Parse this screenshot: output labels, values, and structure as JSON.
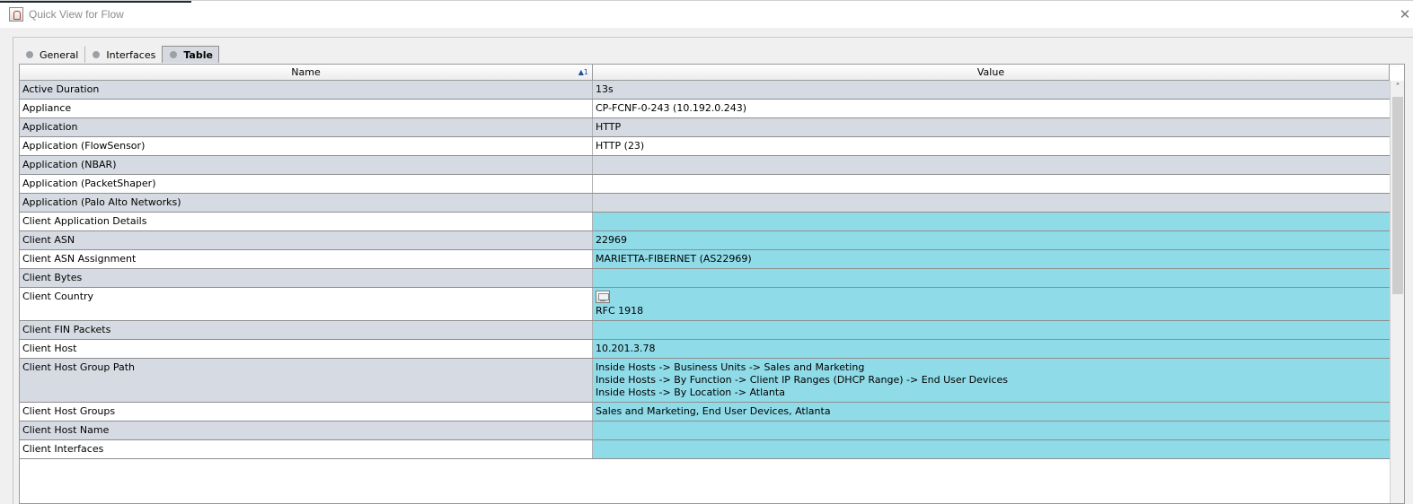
{
  "window": {
    "title": "Quick View for Flow",
    "close_glyph": "✕",
    "app_icon": "java-cup-icon"
  },
  "tabs": [
    {
      "label": "General",
      "active": false
    },
    {
      "label": "Interfaces",
      "active": false
    },
    {
      "label": "Table",
      "active": true
    }
  ],
  "table": {
    "columns": {
      "name": "Name",
      "value": "Value"
    },
    "sort_indicator": "▲1",
    "rows": [
      {
        "name": "Active Duration",
        "value": [
          "13s"
        ],
        "bg": "grey"
      },
      {
        "name": "Appliance",
        "value": [
          "CP-FCNF-0-243 (10.192.0.243)"
        ],
        "bg": "white"
      },
      {
        "name": "Application",
        "value": [
          "HTTP"
        ],
        "bg": "grey"
      },
      {
        "name": "Application (FlowSensor)",
        "value": [
          "HTTP (23)"
        ],
        "bg": "white"
      },
      {
        "name": "Application (NBAR)",
        "value": [
          ""
        ],
        "bg": "grey"
      },
      {
        "name": "Application (PacketShaper)",
        "value": [
          ""
        ],
        "bg": "white"
      },
      {
        "name": "Application (Palo Alto Networks)",
        "value": [
          ""
        ],
        "bg": "grey"
      },
      {
        "name": "Client Application Details",
        "value": [
          ""
        ],
        "bg": "cyan"
      },
      {
        "name": "Client ASN",
        "value": [
          "22969"
        ],
        "bg": "cyan"
      },
      {
        "name": "Client ASN Assignment",
        "value": [
          "MARIETTA-FIBERNET (AS22969)"
        ],
        "bg": "cyan"
      },
      {
        "name": "Client Bytes",
        "value": [
          ""
        ],
        "bg": "cyan"
      },
      {
        "name": "Client Country",
        "value": [
          "RFC 1918"
        ],
        "bg": "cyan",
        "icon": "network-flag-icon"
      },
      {
        "name": "Client FIN Packets",
        "value": [
          ""
        ],
        "bg": "cyan"
      },
      {
        "name": "Client Host",
        "value": [
          "10.201.3.78"
        ],
        "bg": "cyan"
      },
      {
        "name": "Client Host Group Path",
        "value": [
          "Inside Hosts -> Business Units -> Sales and Marketing",
          "Inside Hosts -> By Function -> Client IP Ranges (DHCP Range) -> End User Devices",
          "Inside Hosts -> By Location -> Atlanta"
        ],
        "bg": "cyan"
      },
      {
        "name": "Client Host Groups",
        "value": [
          "Sales and Marketing, End User Devices, Atlanta"
        ],
        "bg": "cyan"
      },
      {
        "name": "Client Host Name",
        "value": [
          ""
        ],
        "bg": "cyan"
      },
      {
        "name": "Client Interfaces",
        "value": [
          ""
        ],
        "bg": "cyan"
      }
    ]
  },
  "colors": {
    "row_alt": "#d6dbe3",
    "highlight": "#8fdbe8"
  }
}
